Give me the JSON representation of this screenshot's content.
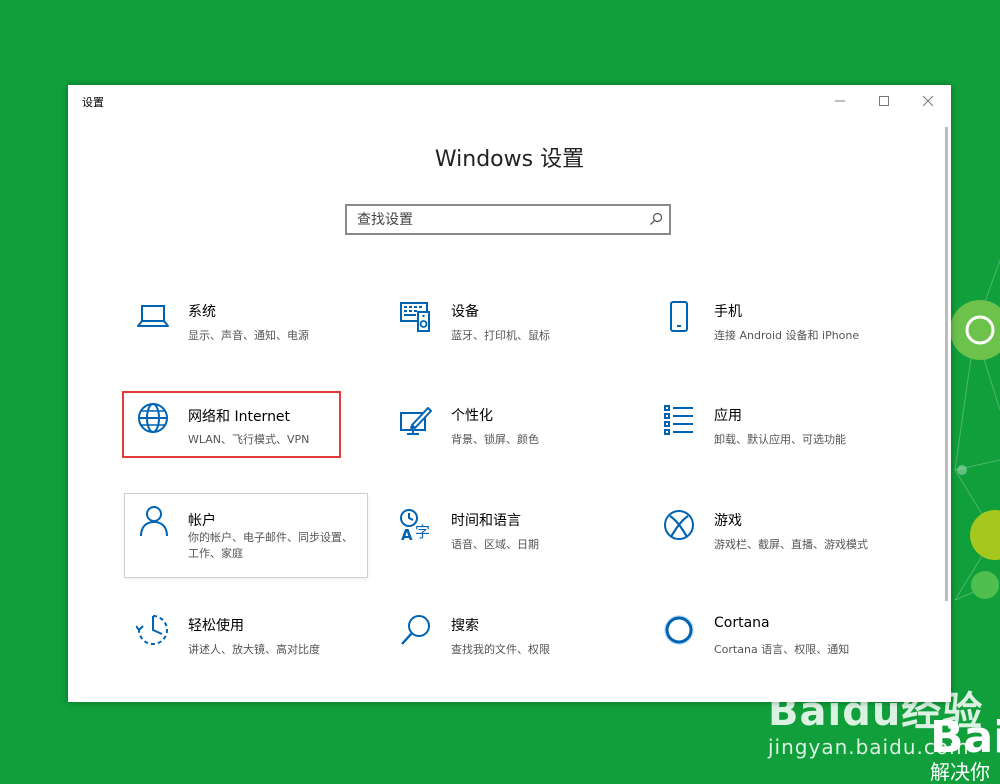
{
  "window": {
    "title": "设置",
    "controls": {
      "minimize": "—",
      "maximize": "☐",
      "close": "✕"
    }
  },
  "page_title": "Windows 设置",
  "search": {
    "placeholder": "查找设置"
  },
  "tiles": [
    {
      "name": "系统",
      "desc": "显示、声音、通知、电源",
      "icon": "laptop-icon"
    },
    {
      "name": "设备",
      "desc": "蓝牙、打印机、鼠标",
      "icon": "devices-icon"
    },
    {
      "name": "手机",
      "desc": "连接 Android 设备和 iPhone",
      "icon": "phone-icon"
    },
    {
      "name": "网络和 Internet",
      "desc": "WLAN、飞行模式、VPN",
      "icon": "globe-icon"
    },
    {
      "name": "个性化",
      "desc": "背景、锁屏、颜色",
      "icon": "paint-icon"
    },
    {
      "name": "应用",
      "desc": "卸载、默认应用、可选功能",
      "icon": "apps-list-icon"
    },
    {
      "name": "帐户",
      "desc": "你的帐户、电子邮件、同步设置、工作、家庭",
      "icon": "person-icon"
    },
    {
      "name": "时间和语言",
      "desc": "语音、区域、日期",
      "icon": "time-language-icon"
    },
    {
      "name": "游戏",
      "desc": "游戏栏、截屏、直播、游戏模式",
      "icon": "xbox-icon"
    },
    {
      "name": "轻松使用",
      "desc": "讲述人、放大镜、高对比度",
      "icon": "ease-of-access-icon"
    },
    {
      "name": "搜索",
      "desc": "查找我的文件、权限",
      "icon": "search-icon"
    },
    {
      "name": "Cortana",
      "desc": "Cortana 语言、权限、通知",
      "icon": "cortana-icon"
    }
  ],
  "colors": {
    "accent": "#0063b1",
    "highlight_border": "#e33b3b",
    "background": "#109f3b"
  },
  "watermark": {
    "logo": "Baidu经验",
    "url": "jingyan.baidu.com",
    "right_text": "Bai",
    "right_subtext": "解决你"
  }
}
